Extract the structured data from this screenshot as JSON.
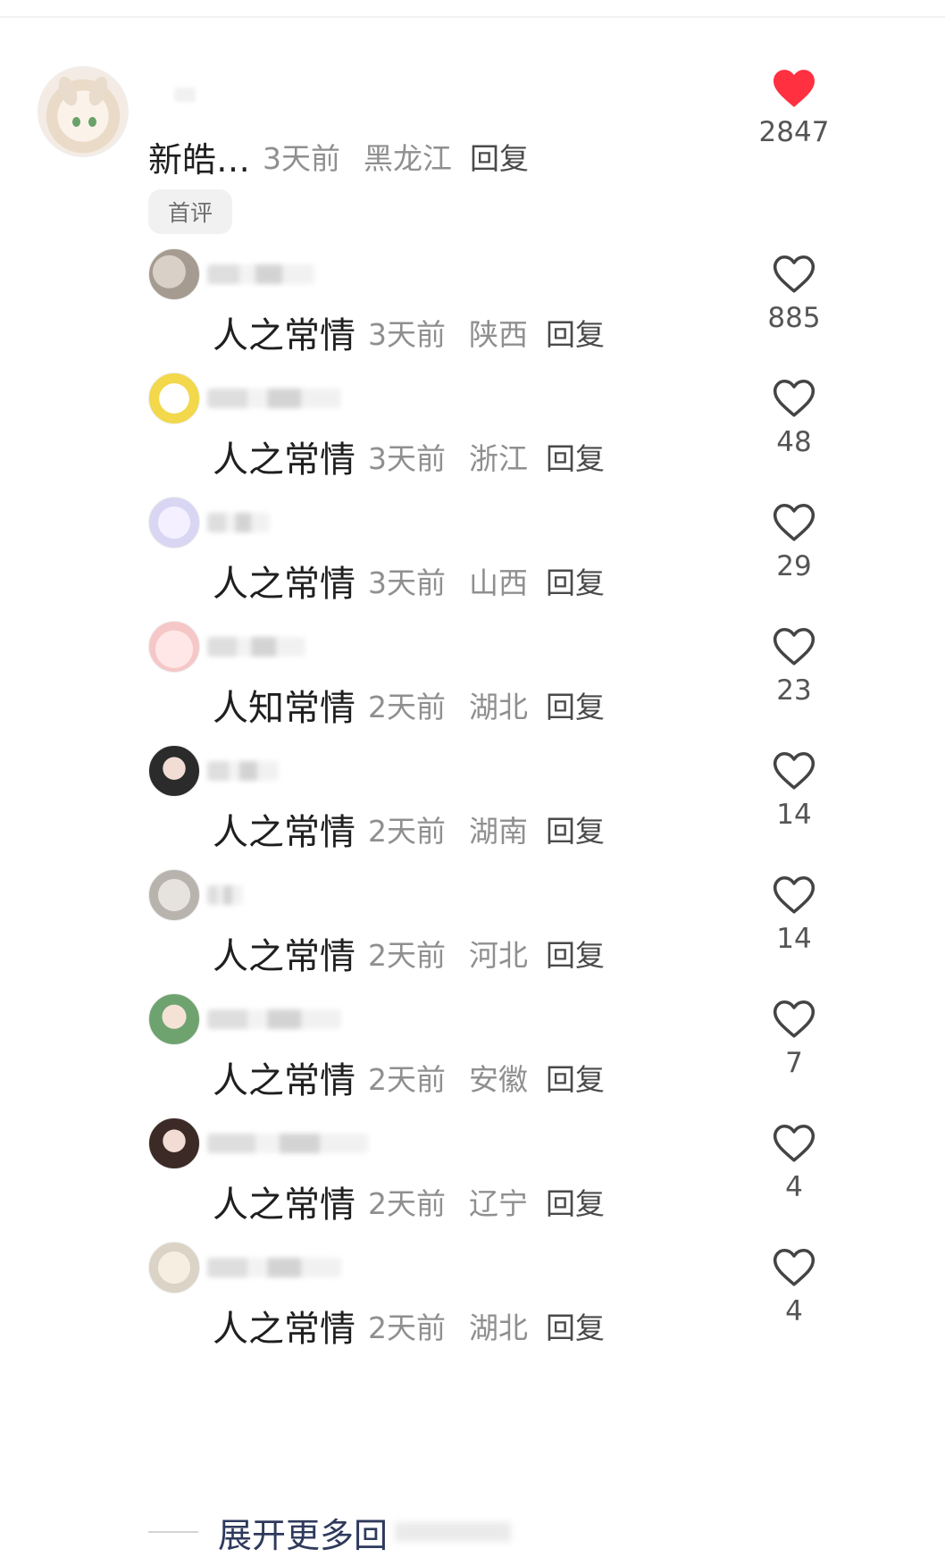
{
  "colors": {
    "liked": "#ff3040",
    "outline": "#444444",
    "meta": "#8f8f8f"
  },
  "main_comment": {
    "text": "新皓…",
    "time": "3天前",
    "location": "黑龙江",
    "reply_label": "回复",
    "badge": "首评",
    "likes": "2847",
    "liked": true,
    "like_icon": "heart-filled-icon"
  },
  "replies": [
    {
      "text": "人之常情",
      "time": "3天前",
      "location": "陕西",
      "reply_label": "回复",
      "likes": "885",
      "liked": false
    },
    {
      "text": "人之常情",
      "time": "3天前",
      "location": "浙江",
      "reply_label": "回复",
      "likes": "48",
      "liked": false
    },
    {
      "text": "人之常情",
      "time": "3天前",
      "location": "山西",
      "reply_label": "回复",
      "likes": "29",
      "liked": false
    },
    {
      "text": "人知常情",
      "time": "2天前",
      "location": "湖北",
      "reply_label": "回复",
      "likes": "23",
      "liked": false
    },
    {
      "text": "人之常情",
      "time": "2天前",
      "location": "湖南",
      "reply_label": "回复",
      "likes": "14",
      "liked": false
    },
    {
      "text": "人之常情",
      "time": "2天前",
      "location": "河北",
      "reply_label": "回复",
      "likes": "14",
      "liked": false
    },
    {
      "text": "人之常情",
      "time": "2天前",
      "location": "安徽",
      "reply_label": "回复",
      "likes": "7",
      "liked": false
    },
    {
      "text": "人之常情",
      "time": "2天前",
      "location": "辽宁",
      "reply_label": "回复",
      "likes": "4",
      "liked": false
    },
    {
      "text": "人之常情",
      "time": "2天前",
      "location": "湖北",
      "reply_label": "回复",
      "likes": "4",
      "liked": false
    }
  ],
  "expand_more": {
    "label": "展开更多回"
  }
}
